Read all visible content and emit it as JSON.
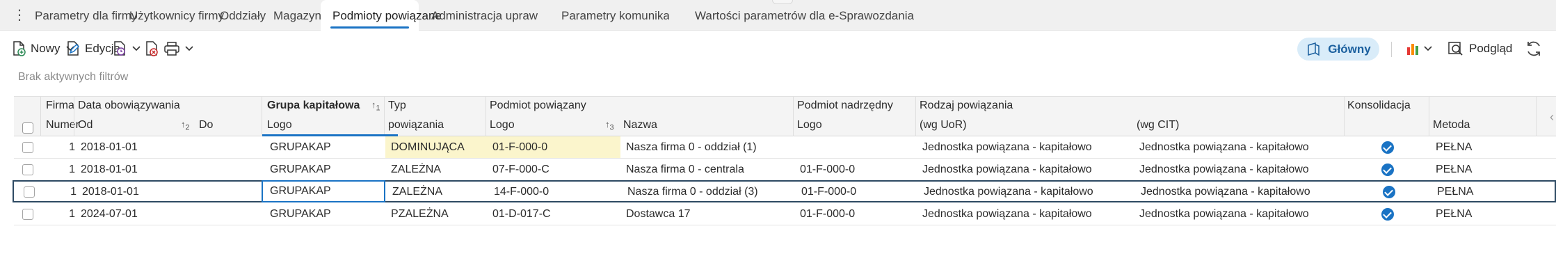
{
  "tabs": [
    {
      "label": "Parametry dla firmy",
      "state": "normal"
    },
    {
      "label": "Użytkownicy firmy",
      "state": "normal"
    },
    {
      "label": "Oddziały",
      "state": "normal"
    },
    {
      "label": "Magazyny",
      "state": "normal"
    },
    {
      "label": "Podmioty powiązane",
      "state": "active"
    },
    {
      "label": "Administracja uprawnieniami",
      "state": "normal"
    },
    {
      "label": "Parametry komunikacji z UPS",
      "state": "normal"
    },
    {
      "label": "Wartości parametrów dla e-Sprawozdania",
      "state": "normal"
    }
  ],
  "toolbar": {
    "new_label": "Nowy",
    "edit_label": "Edycja",
    "main_label": "Główny",
    "preview_label": "Podgląd"
  },
  "filters_text": "Brak aktywnych filtrów",
  "grid": {
    "header_top": {
      "firma": "Firma",
      "data": "Data obowiązywania",
      "grupa": "Grupa kapitałowa",
      "typ": "Typ",
      "podmiot": "Podmiot powiązany",
      "nadrzedny": "Podmiot nadrzędny",
      "rodzaj": "Rodzaj powiązania",
      "konsolidacja": "Konsolidacja"
    },
    "header_bottom": {
      "numer": "Numer",
      "od": "Od",
      "do": "Do",
      "logo_grupa": "Logo",
      "powiazania": "powiązania",
      "logo_podmiot": "Logo",
      "nazwa": "Nazwa",
      "logo_nadrzedny": "Logo",
      "uor": "(wg UoR)",
      "cit": "(wg CIT)",
      "metoda": "Metoda"
    },
    "sort_marks": {
      "grupa": "1",
      "od": "2",
      "podmiot": "3"
    },
    "rows": [
      {
        "numer": "1",
        "od": "2018-01-01",
        "grupa": "GRUPAKAP",
        "typ": "DOMINUJĄCA",
        "logo": "01-F-000-0",
        "nazwa": "Nasza firma 0 - oddział (1)",
        "nadrzedny": "",
        "uor": "Jednostka powiązana - kapitałowo",
        "cit": "Jednostka powiązana - kapitałowo",
        "konsolidacja": true,
        "metoda": "PEŁNA"
      },
      {
        "numer": "1",
        "od": "2018-01-01",
        "grupa": "GRUPAKAP",
        "typ": "ZALEŻNA",
        "logo": "07-F-000-C",
        "nazwa": "Nasza firma 0 - centrala",
        "nadrzedny": "01-F-000-0",
        "uor": "Jednostka powiązana - kapitałowo",
        "cit": "Jednostka powiązana - kapitałowo",
        "konsolidacja": true,
        "metoda": "PEŁNA"
      },
      {
        "numer": "1",
        "od": "2018-01-01",
        "grupa": "GRUPAKAP",
        "typ": "ZALEŻNA",
        "logo": "14-F-000-0",
        "nazwa": "Nasza firma 0 - oddział (3)",
        "nadrzedny": "01-F-000-0",
        "uor": "Jednostka powiązana - kapitałowo",
        "cit": "Jednostka powiązana - kapitałowo",
        "konsolidacja": true,
        "metoda": "PEŁNA"
      },
      {
        "numer": "1",
        "od": "2024-07-01",
        "grupa": "GRUPAKAP",
        "typ": "PZALEŻNA",
        "logo": "01-D-017-C",
        "nazwa": "Dostawca 17",
        "nadrzedny": "01-F-000-0",
        "uor": "Jednostka powiązana - kapitałowo",
        "cit": "Jednostka powiązana - kapitałowo",
        "konsolidacja": true,
        "metoda": "PEŁNA"
      }
    ]
  },
  "colors": {
    "accent": "#1a73c4",
    "highlight": "#fbf5cc",
    "selected_border": "#2e4a63"
  }
}
